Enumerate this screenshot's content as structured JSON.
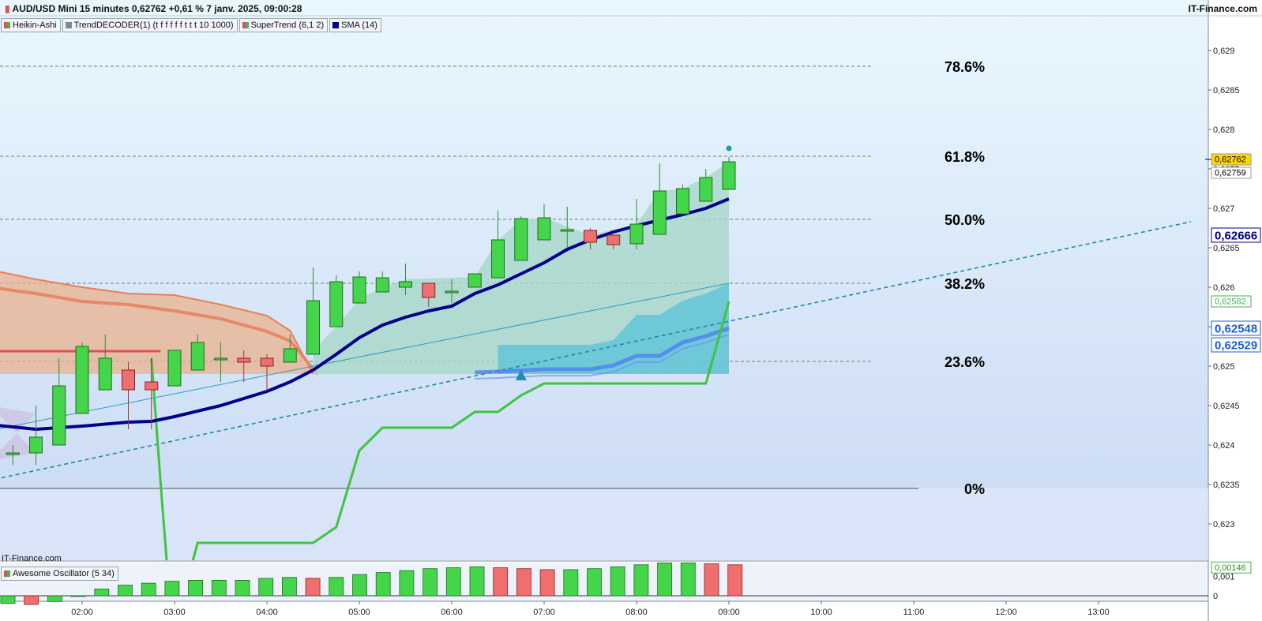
{
  "header": {
    "title": "AUD/USD Mini 15 minutes 0,62762 +0,61 % 7 janv. 2025, 09:00:28",
    "brand": "IT-Finance.com",
    "watermark": "IT-Finance.com"
  },
  "indicators": [
    {
      "label": "Heikin-Ashi",
      "color": "#e05050",
      "color2": "#4caf50"
    },
    {
      "label": "TrendDECODER(1) (t f f f f f t t t 10 1000)",
      "color": "#7d8b99"
    },
    {
      "label": "SuperTrend (6,1 2)",
      "color": "#e05050",
      "color2": "#4caf50"
    },
    {
      "label": "SMA (14)",
      "color": "#00008b"
    }
  ],
  "oscillator": {
    "label": "Awesome Oscillator (5 34)",
    "color": "#e05050",
    "color2": "#4caf50"
  },
  "fib_labels": [
    "78.6%",
    "61.8%",
    "50.0%",
    "38.2%",
    "23.6%",
    "0%"
  ],
  "chart_data": {
    "type": "candlestick",
    "x_axis": {
      "tick_labels": [
        "02:00",
        "03:00",
        "04:00",
        "05:00",
        "06:00",
        "07:00",
        "08:00",
        "09:00",
        "10:00",
        "11:00",
        "12:00",
        "13:00"
      ]
    },
    "y_axis": {
      "tick_labels": [
        "0,629",
        "0,6285",
        "0,628",
        "0,6275",
        "0,627",
        "0,6265",
        "0,626",
        "0,6255",
        "0,625",
        "0,6245",
        "0,624",
        "0,6235",
        "0,623"
      ],
      "range": [
        0.6227,
        0.6292
      ]
    },
    "price_tags": [
      {
        "text": "0,62762",
        "value": 0.62762,
        "bg": "#ffd700",
        "fg": "#000000",
        "bold": false
      },
      {
        "text": "0,62759",
        "value": 0.62745,
        "bg": "#ffffff",
        "fg": "#000000",
        "bold": false
      },
      {
        "text": "0,62666",
        "value": 0.62666,
        "bg": "#ffffff",
        "fg": "#00008b",
        "bold": true
      },
      {
        "text": "0,62582",
        "value": 0.62582,
        "bg": "#ffffff",
        "fg": "#4caf50",
        "bold": false
      },
      {
        "text": "0,62548",
        "value": 0.62548,
        "bg": "#ffffff",
        "fg": "#1a5fd6",
        "bold": true
      },
      {
        "text": "0,62529",
        "value": 0.62527,
        "bg": "#ffffff",
        "fg": "#1a5fd6",
        "bold": true
      }
    ],
    "fib_levels": [
      {
        "label": "78.6%",
        "value": 0.6288
      },
      {
        "label": "61.8%",
        "value": 0.62766
      },
      {
        "label": "50.0%",
        "value": 0.62686
      },
      {
        "label": "38.2%",
        "value": 0.62605
      },
      {
        "label": "23.6%",
        "value": 0.62506
      },
      {
        "label": "0%",
        "value": 0.62345
      }
    ],
    "candles": [
      {
        "time": 1.25,
        "open": 0.6239,
        "high": 0.624,
        "low": 0.62375,
        "close": 0.6239
      },
      {
        "time": 1.5,
        "open": 0.6239,
        "high": 0.6245,
        "low": 0.62375,
        "close": 0.6241
      },
      {
        "time": 1.75,
        "open": 0.624,
        "high": 0.6251,
        "low": 0.624,
        "close": 0.62475
      },
      {
        "time": 2.0,
        "open": 0.6244,
        "high": 0.6253,
        "low": 0.6244,
        "close": 0.62525
      },
      {
        "time": 2.25,
        "open": 0.6247,
        "high": 0.6254,
        "low": 0.6247,
        "close": 0.6251
      },
      {
        "time": 2.5,
        "open": 0.62495,
        "high": 0.62505,
        "low": 0.6242,
        "close": 0.6247
      },
      {
        "time": 2.75,
        "open": 0.6248,
        "high": 0.6251,
        "low": 0.6242,
        "close": 0.6247
      },
      {
        "time": 3.0,
        "open": 0.62475,
        "high": 0.6252,
        "low": 0.62475,
        "close": 0.6252
      },
      {
        "time": 3.25,
        "open": 0.62495,
        "high": 0.6254,
        "low": 0.62495,
        "close": 0.6253
      },
      {
        "time": 3.5,
        "open": 0.6251,
        "high": 0.6253,
        "low": 0.6248,
        "close": 0.6251
      },
      {
        "time": 3.75,
        "open": 0.6251,
        "high": 0.6252,
        "low": 0.6248,
        "close": 0.62505
      },
      {
        "time": 4.0,
        "open": 0.6251,
        "high": 0.62515,
        "low": 0.6247,
        "close": 0.625
      },
      {
        "time": 4.25,
        "open": 0.62505,
        "high": 0.6254,
        "low": 0.62505,
        "close": 0.62522
      },
      {
        "time": 4.5,
        "open": 0.62515,
        "high": 0.62625,
        "low": 0.62515,
        "close": 0.62583
      },
      {
        "time": 4.75,
        "open": 0.6255,
        "high": 0.62615,
        "low": 0.6255,
        "close": 0.62607
      },
      {
        "time": 5.0,
        "open": 0.6258,
        "high": 0.6262,
        "low": 0.6258,
        "close": 0.62613
      },
      {
        "time": 5.25,
        "open": 0.62594,
        "high": 0.6262,
        "low": 0.62594,
        "close": 0.62612
      },
      {
        "time": 5.5,
        "open": 0.626,
        "high": 0.6263,
        "low": 0.6259,
        "close": 0.62607
      },
      {
        "time": 5.75,
        "open": 0.62605,
        "high": 0.62605,
        "low": 0.62575,
        "close": 0.62587
      },
      {
        "time": 6.0,
        "open": 0.62595,
        "high": 0.6261,
        "low": 0.6258,
        "close": 0.62595
      },
      {
        "time": 6.25,
        "open": 0.626,
        "high": 0.62617,
        "low": 0.626,
        "close": 0.62617
      },
      {
        "time": 6.5,
        "open": 0.62612,
        "high": 0.62697,
        "low": 0.62612,
        "close": 0.6266
      },
      {
        "time": 6.75,
        "open": 0.62634,
        "high": 0.6269,
        "low": 0.62634,
        "close": 0.62687
      },
      {
        "time": 7.0,
        "open": 0.6266,
        "high": 0.62705,
        "low": 0.6266,
        "close": 0.62688
      },
      {
        "time": 7.25,
        "open": 0.62672,
        "high": 0.62702,
        "low": 0.6265,
        "close": 0.62673
      },
      {
        "time": 7.5,
        "open": 0.62672,
        "high": 0.62675,
        "low": 0.62648,
        "close": 0.62657
      },
      {
        "time": 7.75,
        "open": 0.62666,
        "high": 0.62666,
        "low": 0.62648,
        "close": 0.62654
      },
      {
        "time": 8.0,
        "open": 0.62655,
        "high": 0.62712,
        "low": 0.62648,
        "close": 0.6268
      },
      {
        "time": 8.25,
        "open": 0.62667,
        "high": 0.62757,
        "low": 0.62667,
        "close": 0.62722
      },
      {
        "time": 8.5,
        "open": 0.62693,
        "high": 0.6273,
        "low": 0.62693,
        "close": 0.62725
      },
      {
        "time": 8.75,
        "open": 0.62709,
        "high": 0.6275,
        "low": 0.62709,
        "close": 0.62739
      },
      {
        "time": 9.0,
        "open": 0.62724,
        "high": 0.62765,
        "low": 0.62724,
        "close": 0.62759
      }
    ],
    "sma14": [
      [
        1.0,
        0.62426
      ],
      [
        1.5,
        0.6242
      ],
      [
        2.0,
        0.62424
      ],
      [
        2.5,
        0.62429
      ],
      [
        2.75,
        0.6243
      ],
      [
        3.0,
        0.62436
      ],
      [
        3.5,
        0.6245
      ],
      [
        4.0,
        0.62468
      ],
      [
        4.25,
        0.6248
      ],
      [
        4.5,
        0.62495
      ],
      [
        4.75,
        0.62515
      ],
      [
        5.0,
        0.62536
      ],
      [
        5.25,
        0.62552
      ],
      [
        5.5,
        0.62562
      ],
      [
        5.75,
        0.6257
      ],
      [
        6.0,
        0.62576
      ],
      [
        6.25,
        0.62592
      ],
      [
        6.5,
        0.62603
      ],
      [
        6.75,
        0.62617
      ],
      [
        7.0,
        0.62631
      ],
      [
        7.25,
        0.62648
      ],
      [
        7.5,
        0.6266
      ],
      [
        7.75,
        0.6267
      ],
      [
        8.0,
        0.62678
      ],
      [
        8.25,
        0.62685
      ],
      [
        8.5,
        0.62692
      ],
      [
        8.75,
        0.627
      ],
      [
        9.0,
        0.62712
      ]
    ],
    "supertrend": [
      [
        2.75,
        0.6251
      ],
      [
        2.85,
        0.6235
      ],
      [
        2.95,
        0.622
      ],
      [
        3.05,
        0.6219
      ],
      [
        3.25,
        0.62276
      ],
      [
        4.5,
        0.62276
      ],
      [
        4.75,
        0.62296
      ],
      [
        5.0,
        0.62393
      ],
      [
        5.25,
        0.62422
      ],
      [
        6.0,
        0.62422
      ],
      [
        6.25,
        0.62442
      ],
      [
        6.5,
        0.62442
      ],
      [
        6.75,
        0.62463
      ],
      [
        7.0,
        0.62478
      ],
      [
        8.75,
        0.62478
      ],
      [
        9.0,
        0.62582
      ]
    ],
    "cloud_upper": [
      [
        1.0,
        0.62622
      ],
      [
        1.5,
        0.6261
      ],
      [
        2.0,
        0.626
      ],
      [
        2.5,
        0.62592
      ],
      [
        3.0,
        0.6259
      ],
      [
        3.5,
        0.62578
      ],
      [
        4.0,
        0.62564
      ],
      [
        4.25,
        0.62545
      ],
      [
        4.5,
        0.6252
      ],
      [
        4.75,
        0.6255
      ],
      [
        5.0,
        0.62585
      ],
      [
        5.25,
        0.626
      ],
      [
        5.5,
        0.6261
      ],
      [
        6.0,
        0.62612
      ],
      [
        6.25,
        0.62613
      ],
      [
        6.5,
        0.6266
      ],
      [
        6.75,
        0.62685
      ],
      [
        7.0,
        0.62688
      ],
      [
        7.5,
        0.62666
      ],
      [
        8.0,
        0.6268
      ],
      [
        8.25,
        0.62722
      ],
      [
        8.5,
        0.62725
      ],
      [
        8.75,
        0.62739
      ],
      [
        9.0,
        0.62759
      ]
    ],
    "cloud_lower": [
      [
        1.0,
        0.6249
      ],
      [
        4.5,
        0.6249
      ],
      [
        6.0,
        0.6249
      ],
      [
        6.75,
        0.6249
      ],
      [
        7.25,
        0.6249
      ],
      [
        9.0,
        0.6249
      ]
    ],
    "teal_zone_upper": [
      [
        6.5,
        0.62527
      ],
      [
        7.5,
        0.62527
      ],
      [
        7.75,
        0.62533
      ],
      [
        8.0,
        0.62565
      ],
      [
        8.25,
        0.62565
      ],
      [
        8.5,
        0.62583
      ],
      [
        8.75,
        0.62592
      ],
      [
        9.0,
        0.62605
      ]
    ],
    "teal_zone_lower": [
      [
        6.5,
        0.6249
      ],
      [
        9.0,
        0.6249
      ]
    ],
    "blue_band": [
      [
        6.25,
        0.62492
      ],
      [
        6.5,
        0.62493
      ],
      [
        7.0,
        0.62496
      ],
      [
        7.5,
        0.62496
      ],
      [
        7.75,
        0.62501
      ],
      [
        8.0,
        0.62513
      ],
      [
        8.25,
        0.62513
      ],
      [
        8.5,
        0.6253
      ],
      [
        8.75,
        0.62538
      ],
      [
        9.0,
        0.62548
      ]
    ],
    "trend_line": [
      [
        0.0,
        0.6233
      ],
      [
        14.0,
        0.62683
      ]
    ],
    "thin_line": [
      [
        0.0,
        0.62395
      ],
      [
        9.0,
        0.62605
      ]
    ],
    "signal_arrow": {
      "time": 6.75,
      "value": 0.6249
    },
    "signal_dot": {
      "time": 9.0,
      "value": 0.62776
    },
    "ao_values": [
      -0.0004,
      -0.00045,
      -0.0003,
      0.0,
      0.00035,
      0.00055,
      0.00065,
      0.00075,
      0.0008,
      0.0008,
      0.0008,
      0.0009,
      0.00095,
      0.0009,
      0.00095,
      0.0011,
      0.0012,
      0.0013,
      0.0014,
      0.00145,
      0.0015,
      0.00145,
      0.0014,
      0.00135,
      0.00135,
      0.0014,
      0.0015,
      0.0016,
      0.0017,
      0.0017,
      0.00165,
      0.0016,
      0.00155,
      0.00155,
      0.00165,
      0.00175,
      0.00185,
      0.0018,
      0.00175,
      0.0017,
      0.00165,
      0.0016,
      0.00165,
      0.00175,
      0.0018,
      0.0017,
      0.00165,
      0.0016
    ],
    "ao_axis": {
      "tick_labels": [
        "0,001",
        "0"
      ],
      "range": [
        -0.0002,
        0.002
      ],
      "last_label": "0,00146"
    }
  }
}
